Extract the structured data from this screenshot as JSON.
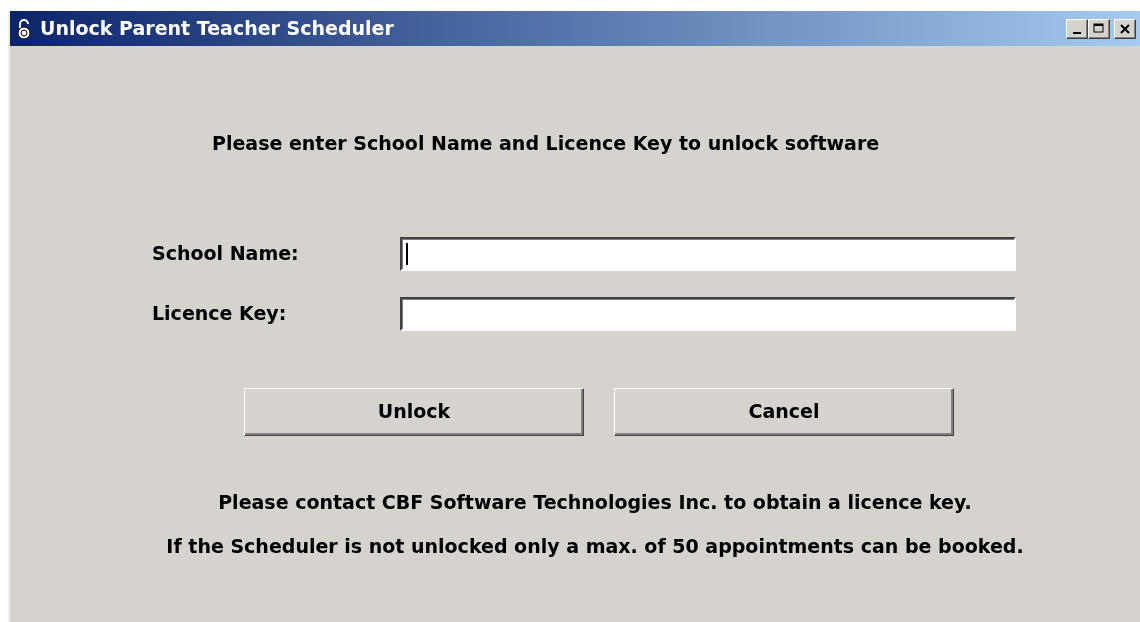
{
  "window": {
    "title": "Unlock Parent Teacher Scheduler"
  },
  "heading": "Please enter School Name and Licence Key to unlock software",
  "fields": [
    {
      "label": "School Name:",
      "focused": true
    },
    {
      "label": "Licence Key:",
      "focused": false
    }
  ],
  "buttons": [
    "Unlock",
    "Cancel"
  ],
  "notes": [
    "Please contact CBF Software Technologies Inc. to obtain a licence key.",
    "If the Scheduler is not unlocked only a max. of 50 appointments can be booked."
  ]
}
